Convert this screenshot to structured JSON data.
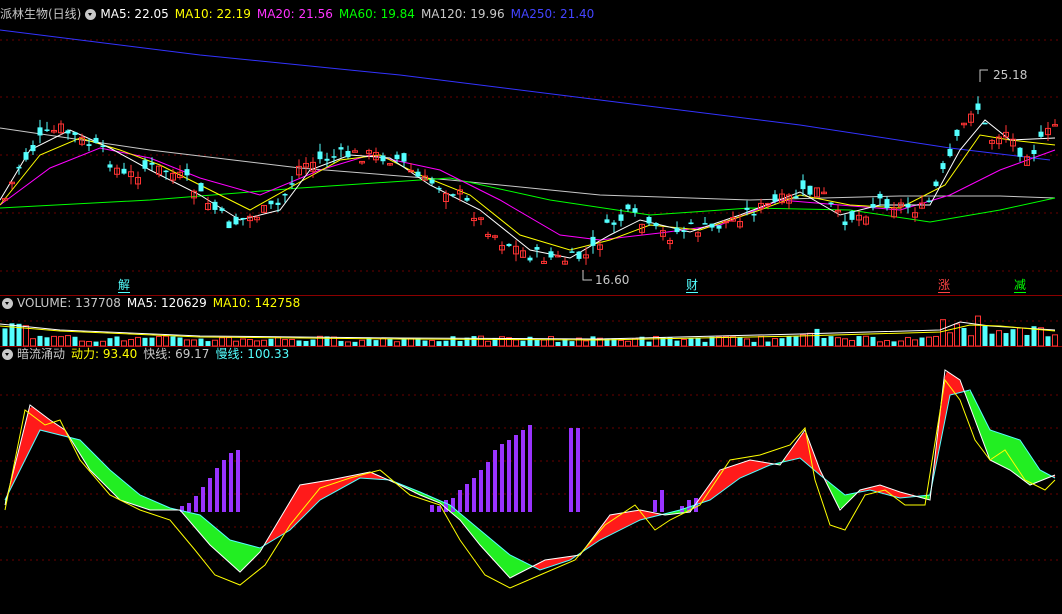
{
  "main_legend": {
    "title": "派林生物(日线)",
    "ma5": "MA5: 22.05",
    "ma10": "MA10: 22.19",
    "ma20": "MA20: 21.56",
    "ma60": "MA60: 19.84",
    "ma120": "MA120: 19.96",
    "ma250": "MA250: 21.40"
  },
  "volume_legend": {
    "title": "VOLUME: 137708",
    "ma5": "MA5: 120629",
    "ma10": "MA10: 142758"
  },
  "indicator_legend": {
    "title": "暗流涌动",
    "power": "动力: 93.40",
    "fast": "快线: 69.17",
    "slow": "慢线: 100.33"
  },
  "annotations": {
    "high": "25.18",
    "low": "16.60",
    "markers": [
      "解",
      "财",
      "涨",
      "减"
    ]
  },
  "colors": {
    "up": "#ff3333",
    "down": "#54ffff",
    "ma5": "#ffffff",
    "ma10": "#ffff00",
    "ma20": "#ff00ff",
    "ma60": "#00ff00",
    "ma120": "#c8c8c8",
    "ma250": "#3333ff",
    "purple": "#9933ff"
  }
}
